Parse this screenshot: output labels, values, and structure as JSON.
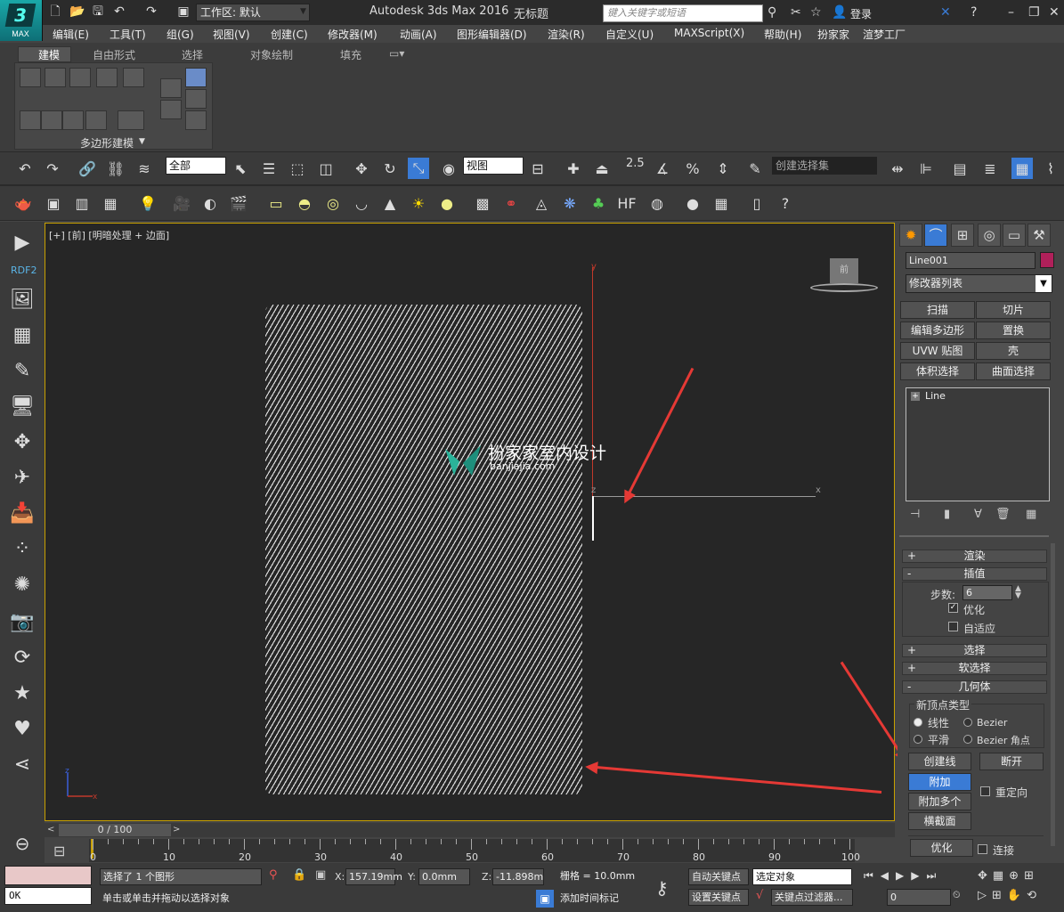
{
  "titlebar": {
    "logo_text": "MAX",
    "workspace": "工作区: 默认",
    "app_title": "Autodesk 3ds Max 2016",
    "document": "无标题",
    "search_placeholder": "键入关键字或短语",
    "login": "登录"
  },
  "menus": [
    "编辑(E)",
    "工具(T)",
    "组(G)",
    "视图(V)",
    "创建(C)",
    "修改器(M)",
    "动画(A)",
    "图形编辑器(D)",
    "渲染(R)",
    "自定义(U)",
    "MAXScript(X)",
    "帮助(H)",
    "扮家家",
    "渲梦工厂"
  ],
  "ribbon": {
    "tabs": [
      "建模",
      "自由形式",
      "选择",
      "对象绘制",
      "填充"
    ],
    "panel_label": "多边形建模"
  },
  "toolbar": {
    "filter": "全部",
    "ref_coord": "视图",
    "snap_value": "2.5",
    "selection_set": "创建选择集"
  },
  "sidebar": {
    "rdf_label": "RDF2"
  },
  "viewport": {
    "label": "[+] [前] [明暗处理 + 边面]",
    "cube_label": "前",
    "axis_y": "y",
    "axis_x": "x",
    "axis_z": "z",
    "watermark_title": "扮家家室内设计",
    "watermark_url": "banjiajia.com"
  },
  "command_panel": {
    "object_name": "Line001",
    "modifier_list": "修改器列表",
    "modifier_buttons": [
      "扫描",
      "切片",
      "编辑多边形",
      "置换",
      "UVW 贴图",
      "壳",
      "体积选择",
      "曲面选择"
    ],
    "stack_item": "Line",
    "rollouts": {
      "render": "渲染",
      "interpolation": "插值",
      "steps_label": "步数:",
      "steps_value": "6",
      "optimize": "优化",
      "adaptive": "自适应",
      "selection": "选择",
      "soft_selection": "软选择",
      "geometry": "几何体",
      "new_vertex_type": "新顶点类型",
      "linear": "线性",
      "bezier": "Bezier",
      "smooth": "平滑",
      "bezier_corner": "Bezier 角点",
      "create_line": "创建线",
      "break": "断开",
      "attach": "附加",
      "reorient": "重定向",
      "attach_multiple": "附加多个",
      "cross_section": "横截面",
      "optimize_btn": "优化",
      "connect": "连接"
    }
  },
  "timeline": {
    "slider": "0 / 100",
    "ticks": [
      "0",
      "10",
      "20",
      "30",
      "40",
      "50",
      "60",
      "70",
      "80",
      "90",
      "100"
    ]
  },
  "statusbar": {
    "maxscript": "OK",
    "selection_info": "选择了 1 个图形",
    "prompt": "单击或单击并拖动以选择对象",
    "x_label": "X:",
    "x_value": "157.19mm",
    "y_label": "Y:",
    "y_value": "0.0mm",
    "z_label": "Z:",
    "z_value": "-11.898mm",
    "grid": "栅格 = 10.0mm",
    "add_time_tag": "添加时间标记",
    "auto_key": "自动关键点",
    "set_key": "设置关键点",
    "selected_object": "选定对象",
    "key_filters": "关键点过滤器...",
    "frame": "0"
  }
}
